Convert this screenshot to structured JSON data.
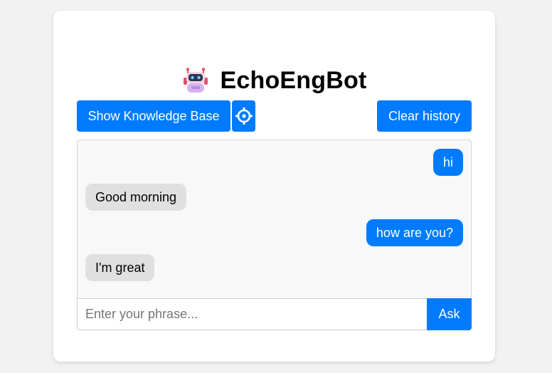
{
  "app": {
    "title": "EchoEngBot",
    "icon": "robot-icon"
  },
  "toolbar": {
    "knowledge_base_label": "Show Knowledge Base",
    "settings_icon": "gear-icon",
    "clear_history_label": "Clear history"
  },
  "chat": {
    "messages": [
      {
        "role": "user",
        "text": "hi"
      },
      {
        "role": "bot",
        "text": "Good morning"
      },
      {
        "role": "user",
        "text": "how are you?"
      },
      {
        "role": "bot",
        "text": "I'm great"
      }
    ]
  },
  "input": {
    "value": "",
    "placeholder": "Enter your phrase...",
    "ask_label": "Ask"
  },
  "colors": {
    "accent": "#007bff",
    "user_bubble": "#007bff",
    "bot_bubble": "#e0e0e0",
    "page_background": "#f2f2f2",
    "chat_background": "#f8f8f8"
  }
}
